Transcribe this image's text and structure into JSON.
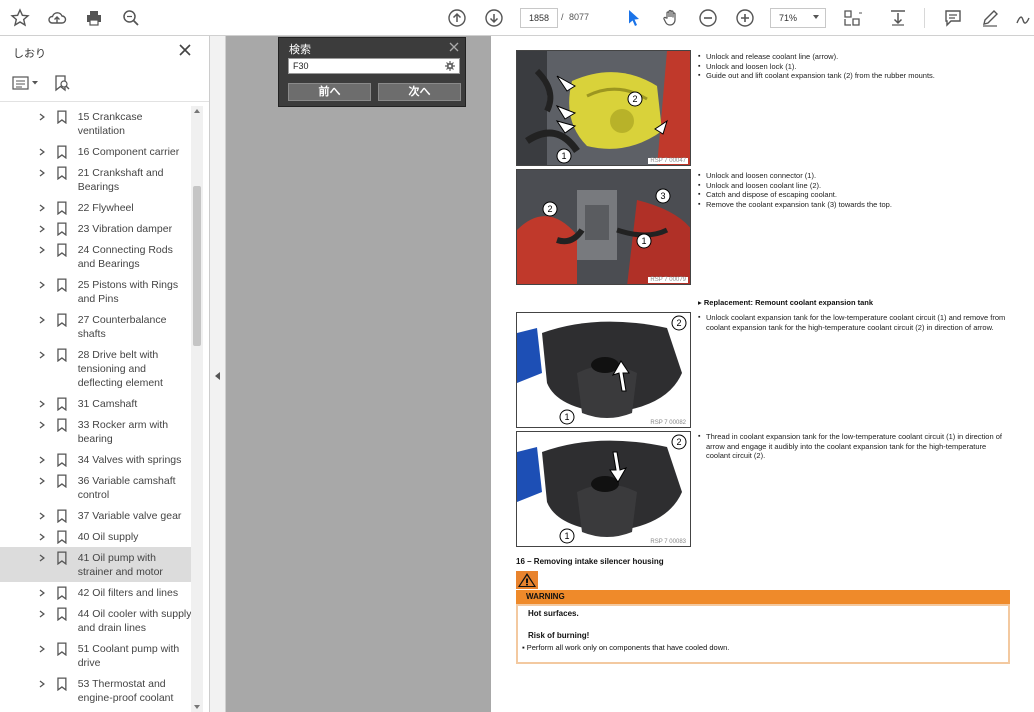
{
  "toolbar": {
    "page_current": "1858",
    "page_sep": "/",
    "page_total": "8077",
    "zoom": "71%",
    "icons": [
      "star-icon",
      "cloud-upload-icon",
      "print-icon",
      "zoom-search-icon",
      "arrow-up-circle-icon",
      "arrow-down-circle-icon",
      "select-cursor-icon",
      "hand-icon",
      "zoom-out-icon",
      "zoom-in-icon",
      "fit-page-icon",
      "scroll-mode-icon",
      "comment-icon",
      "pen-icon",
      "sign-icon"
    ]
  },
  "sidebar": {
    "title": "しおり",
    "bookmarks": [
      {
        "label": "15 Crankcase ventilation",
        "selected": false
      },
      {
        "label": "16 Component carrier",
        "selected": false
      },
      {
        "label": "21 Crankshaft and Bearings",
        "selected": false
      },
      {
        "label": "22 Flywheel",
        "selected": false
      },
      {
        "label": "23 Vibration damper",
        "selected": false
      },
      {
        "label": "24 Connecting Rods and Bearings",
        "selected": false
      },
      {
        "label": "25 Pistons with Rings and Pins",
        "selected": false
      },
      {
        "label": "27 Counterbalance shafts",
        "selected": false
      },
      {
        "label": "28 Drive belt with tensioning and deflecting element",
        "selected": false
      },
      {
        "label": "31 Camshaft",
        "selected": false
      },
      {
        "label": "33 Rocker arm with bearing",
        "selected": false
      },
      {
        "label": "34 Valves with springs",
        "selected": false
      },
      {
        "label": "36 Variable camshaft control",
        "selected": false
      },
      {
        "label": "37 Variable valve gear",
        "selected": false
      },
      {
        "label": "40 Oil supply",
        "selected": false
      },
      {
        "label": "41 Oil pump with strainer and motor",
        "selected": true
      },
      {
        "label": "42 Oil filters and lines",
        "selected": false
      },
      {
        "label": "44 Oil cooler with supply and drain lines",
        "selected": false
      },
      {
        "label": "51 Coolant pump with drive",
        "selected": false
      },
      {
        "label": "53 Thermostat and engine-proof coolant",
        "selected": false
      }
    ]
  },
  "find": {
    "title": "検索",
    "query": "F30",
    "prev_label": "前へ",
    "next_label": "次へ"
  },
  "document": {
    "photos": [
      {
        "code": "RSP 7 00047",
        "callouts": [
          "1",
          "2"
        ]
      },
      {
        "code": "RSP 7 00079",
        "callouts": [
          "1",
          "2",
          "3"
        ]
      },
      {
        "code": "RSP 7 00082",
        "callouts": [
          "1",
          "2"
        ]
      },
      {
        "code": "RSP 7 00083",
        "callouts": [
          "1",
          "2"
        ]
      }
    ],
    "step1": [
      "Unlock and release coolant line (arrow).",
      "Unlock and loosen lock (1).",
      "Guide out and lift coolant expansion tank (2) from the rubber mounts."
    ],
    "step2": [
      "Unlock and loosen connector (1).",
      "Unlock and loosen coolant line (2).",
      "Catch and dispose of escaping coolant.",
      "Remove the coolant expansion tank (3) towards the top."
    ],
    "replacement_heading": "Replacement: Remount coolant expansion tank",
    "step3": [
      "Unlock coolant expansion tank for the low-temperature coolant circuit (1) and remove from coolant expansion tank for the high-temperature coolant circuit (2) in direction of arrow."
    ],
    "step4": [
      "Thread in coolant expansion tank for the low-temperature coolant circuit (1) in direction of arrow and engage it audibly into the coolant expansion tank for the high-temperature coolant circuit (2)."
    ],
    "section_heading": "16 – Removing intake silencer housing",
    "warning": {
      "title": "WARNING",
      "line1": "Hot surfaces.",
      "line2": "Risk of burning!",
      "bullet": "Perform all work only on components that have cooled down."
    }
  },
  "colors": {
    "accent_blue": "#1a73e8",
    "warning_orange": "#ef8a2a",
    "doc_background": "#a8a8a8"
  }
}
